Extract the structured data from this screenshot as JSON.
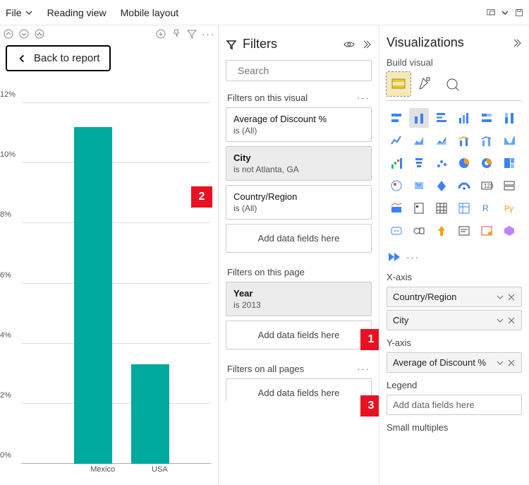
{
  "topbar": {
    "file": "File",
    "reading_view": "Reading view",
    "mobile_layout": "Mobile layout"
  },
  "chart": {
    "back_label": "Back to report"
  },
  "chart_data": {
    "type": "bar",
    "categories": [
      "Mexico",
      "USA"
    ],
    "values": [
      11.2,
      3.3
    ],
    "title": "",
    "xlabel": "",
    "ylabel": "",
    "ylim": [
      0,
      12
    ],
    "y_ticks": [
      "0%",
      "2%",
      "4%",
      "6%",
      "8%",
      "10%",
      "12%"
    ]
  },
  "markers": {
    "m1": "1",
    "m2": "2",
    "m3": "3"
  },
  "filters": {
    "title": "Filters",
    "search_placeholder": "Search",
    "visual_section": "Filters on this visual",
    "page_section": "Filters on this page",
    "all_section": "Filters on all pages",
    "add_fields": "Add data fields here",
    "cards": {
      "discount_name": "Average of Discount %",
      "discount_val": "is (All)",
      "city_name": "City",
      "city_val": "is not Atlanta, GA",
      "country_name": "Country/Region",
      "country_val": "is (All)",
      "year_name": "Year",
      "year_val": "is 2013"
    }
  },
  "viz": {
    "title": "Visualizations",
    "build": "Build visual",
    "xaxis_label": "X-axis",
    "yaxis_label": "Y-axis",
    "legend_label": "Legend",
    "small_multiples": "Small multiples",
    "field_country": "Country/Region",
    "field_city": "City",
    "field_discount": "Average of Discount %",
    "add_fields": "Add data fields here",
    "ellipsis": "···",
    "icons": [
      "stacked-bar-icon",
      "stacked-column-icon",
      "clustered-bar-icon",
      "clustered-column-icon",
      "100-stacked-bar-icon",
      "100-stacked-column-icon",
      "line-icon",
      "area-icon",
      "stacked-area-icon",
      "line-stacked-column-icon",
      "line-clustered-column-icon",
      "ribbon-icon",
      "waterfall-icon",
      "funnel-icon",
      "scatter-icon",
      "pie-icon",
      "donut-icon",
      "treemap-icon",
      "map-icon",
      "filled-map-icon",
      "azure-map-icon",
      "gauge-icon",
      "card-icon",
      "multi-card-icon",
      "kpi-icon",
      "slicer-icon",
      "table-icon",
      "matrix-icon",
      "r-visual-icon",
      "py-visual-icon",
      "qa-icon",
      "key-influencers-icon",
      "decomposition-icon",
      "narrative-icon",
      "paginated-icon",
      "powerapps-icon"
    ]
  }
}
